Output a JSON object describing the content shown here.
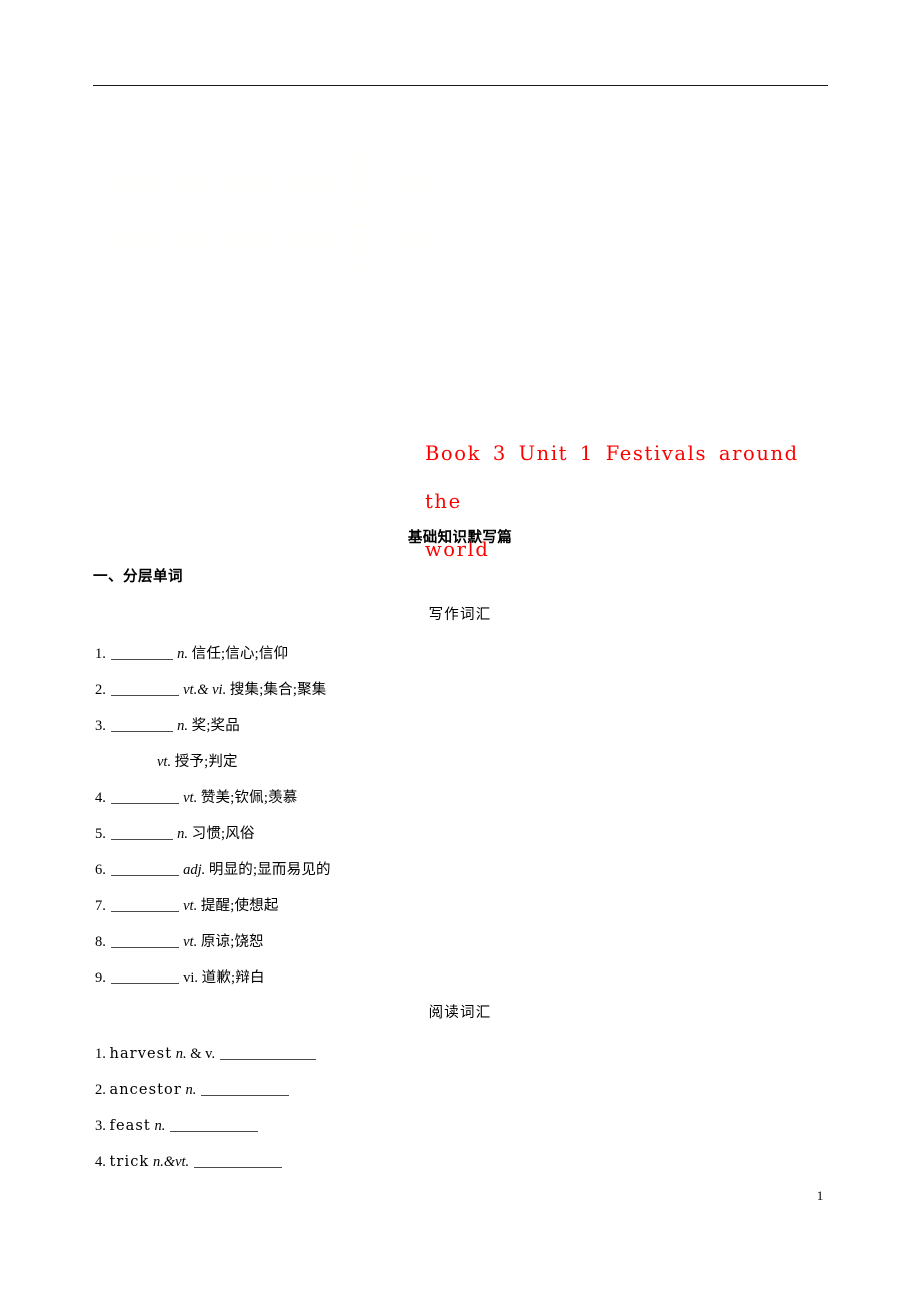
{
  "document": {
    "title_line1": "Book 3  Unit 1  Festivals around the",
    "title_line2": "world",
    "subtitle": "基础知识默写篇",
    "section_heading": "一、分层单词",
    "page_number": "1",
    "title_color": "#ff0000"
  },
  "groups": {
    "writing": {
      "heading": "写作词汇",
      "items": [
        {
          "num": "1.",
          "pos": "n.",
          "pos_style": "italic",
          "meaning": "信任;信心;信仰",
          "blank": "short"
        },
        {
          "num": "2.",
          "pos": "vt.& vi.",
          "pos_style": "italic",
          "meaning": "搜集;集合;聚集",
          "blank": "mid"
        },
        {
          "num": "3.",
          "pos": "n.",
          "pos_style": "italic",
          "meaning": "奖;奖品",
          "blank": "short"
        },
        {
          "num": "",
          "pos": "vt.",
          "pos_style": "italic",
          "meaning": "授予;判定",
          "blank": "none"
        },
        {
          "num": "4.",
          "pos": "vt.",
          "pos_style": "italic",
          "meaning": "赞美;钦佩;羡慕",
          "blank": "mid"
        },
        {
          "num": "5.",
          "pos": "n.",
          "pos_style": "italic",
          "meaning": "习惯;风俗",
          "blank": "short"
        },
        {
          "num": "6.",
          "pos": "adj.",
          "pos_style": "italic",
          "meaning": "明显的;显而易见的",
          "blank": "mid"
        },
        {
          "num": "7.",
          "pos": "vt.",
          "pos_style": "italic",
          "meaning": "提醒;使想起",
          "blank": "mid"
        },
        {
          "num": "8.",
          "pos": "vt.",
          "pos_style": "italic",
          "meaning": "原谅;饶恕",
          "blank": "mid"
        },
        {
          "num": "9.",
          "pos": "vi.",
          "pos_style": "upright",
          "meaning": "道歉;辩白",
          "blank": "mid"
        }
      ]
    },
    "reading": {
      "heading": "阅读词汇",
      "items": [
        {
          "num": "1.",
          "word": "harvest",
          "pos": "n.",
          "pos_style": "italic",
          "pos_extra": "& v.",
          "blank": "xlong"
        },
        {
          "num": "2.",
          "word": "ancestor",
          "pos": "n.",
          "pos_style": "italic",
          "pos_extra": "",
          "blank": "long"
        },
        {
          "num": "3.",
          "word": "feast",
          "pos": "n.",
          "pos_style": "italic",
          "pos_extra": "",
          "blank": "long"
        },
        {
          "num": "4.",
          "word": "trick",
          "pos": "n.&vt.",
          "pos_style": "italic",
          "pos_extra": "",
          "blank": "long"
        }
      ]
    }
  }
}
